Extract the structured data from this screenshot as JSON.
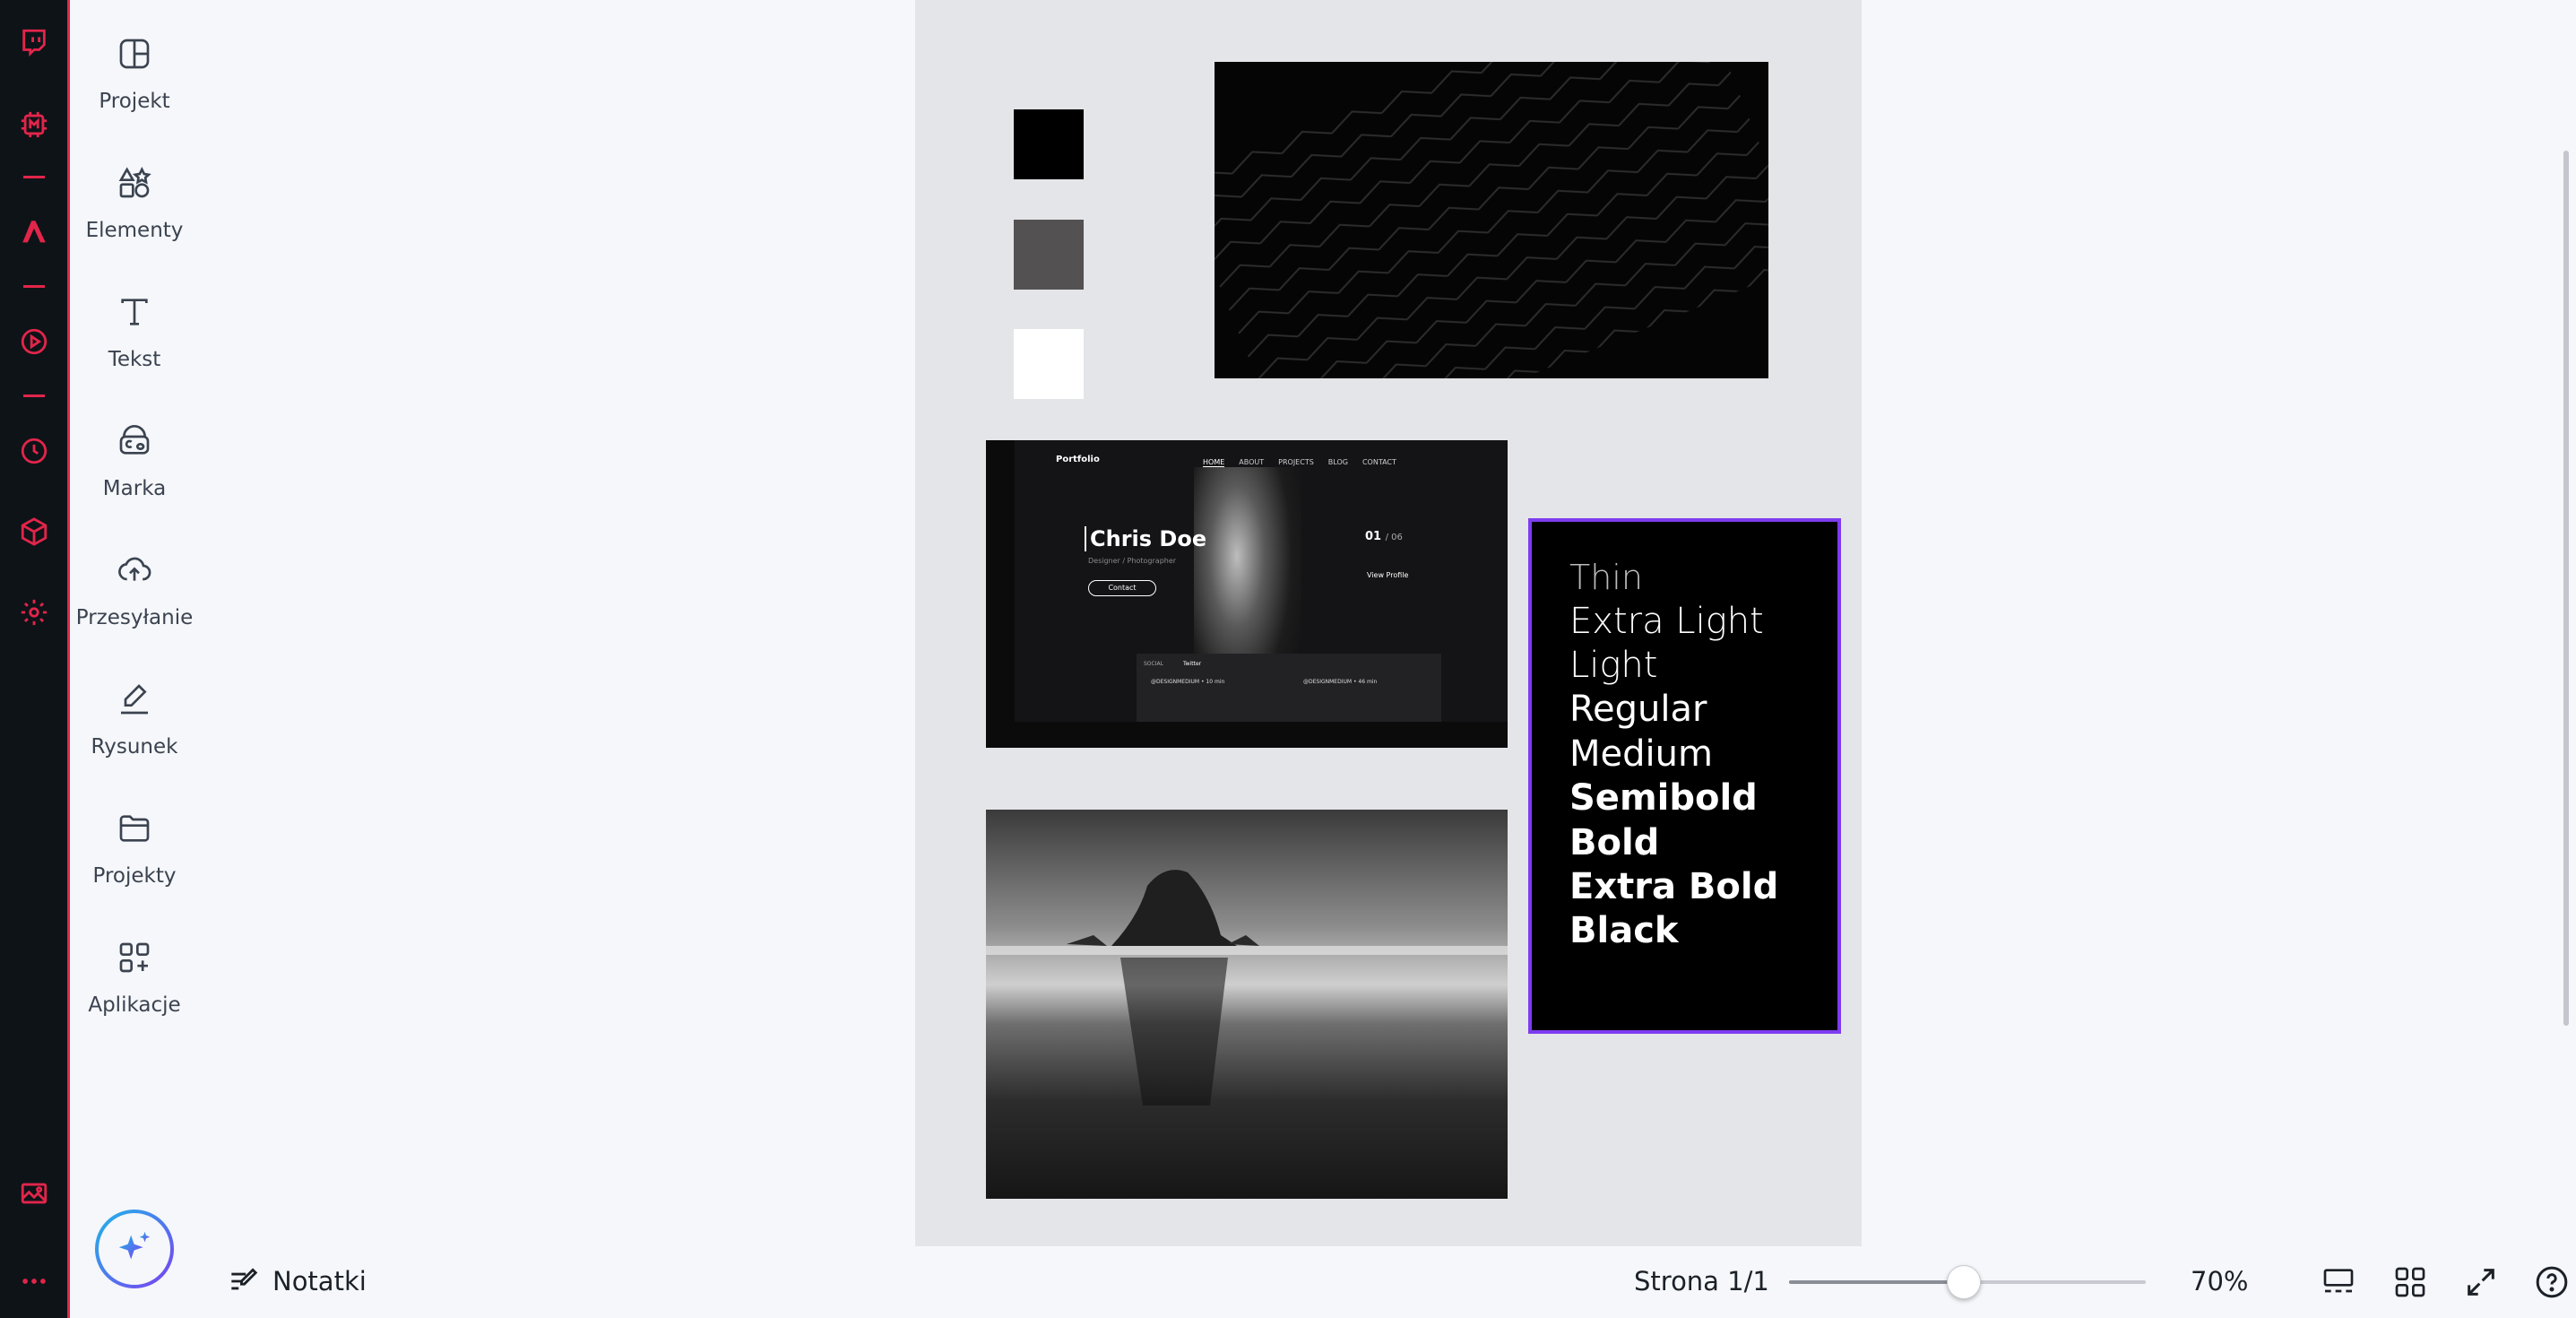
{
  "app": {
    "accent": "#e2254a",
    "selection_color": "#7d3cf0"
  },
  "rail": {
    "icons": [
      "twitch-icon",
      "memory-chip-icon",
      "pen-tool-icon",
      "play-circle-icon",
      "clock-icon",
      "cube-icon",
      "settings-icon",
      "gallery-icon",
      "more-icon"
    ]
  },
  "tools": [
    {
      "label": "Projekt",
      "icon": "layout-icon"
    },
    {
      "label": "Elementy",
      "icon": "shapes-icon"
    },
    {
      "label": "Tekst",
      "icon": "text-icon"
    },
    {
      "label": "Marka",
      "icon": "brand-icon"
    },
    {
      "label": "Przesyłanie",
      "icon": "cloud-upload-icon"
    },
    {
      "label": "Rysunek",
      "icon": "draw-icon"
    },
    {
      "label": "Projekty",
      "icon": "folder-icon"
    },
    {
      "label": "Aplikacje",
      "icon": "apps-icon"
    }
  ],
  "canvas": {
    "swatches": [
      "#000000",
      "#535152",
      "#ffffff"
    ],
    "portfolio": {
      "brand": "Portfolio",
      "nav": [
        "HOME",
        "ABOUT",
        "PROJECTS",
        "BLOG",
        "CONTACT"
      ],
      "name": "Chris Doe",
      "subtitle": "Designer / Photographer",
      "contact": "Contact",
      "counter": "01",
      "counter_total": "/ 06",
      "view_profile": "View Profile",
      "panel_label": "SOCIAL",
      "panel_tab": "Twitter",
      "post1": "@DESIGNMEDIUM • 10 min",
      "post2": "@DESIGNMEDIUM • 46 min"
    },
    "font_weights": [
      "Thin",
      "Extra Light",
      "Light",
      "Regular",
      "Medium",
      "Semibold",
      "Bold",
      "Extra Bold",
      "Black"
    ]
  },
  "bottom": {
    "notes_label": "Notatki",
    "page_indicator": "Strona 1/1",
    "zoom_percent": 70,
    "zoom_label": "70%",
    "zoom_slider_fraction": 0.49
  }
}
